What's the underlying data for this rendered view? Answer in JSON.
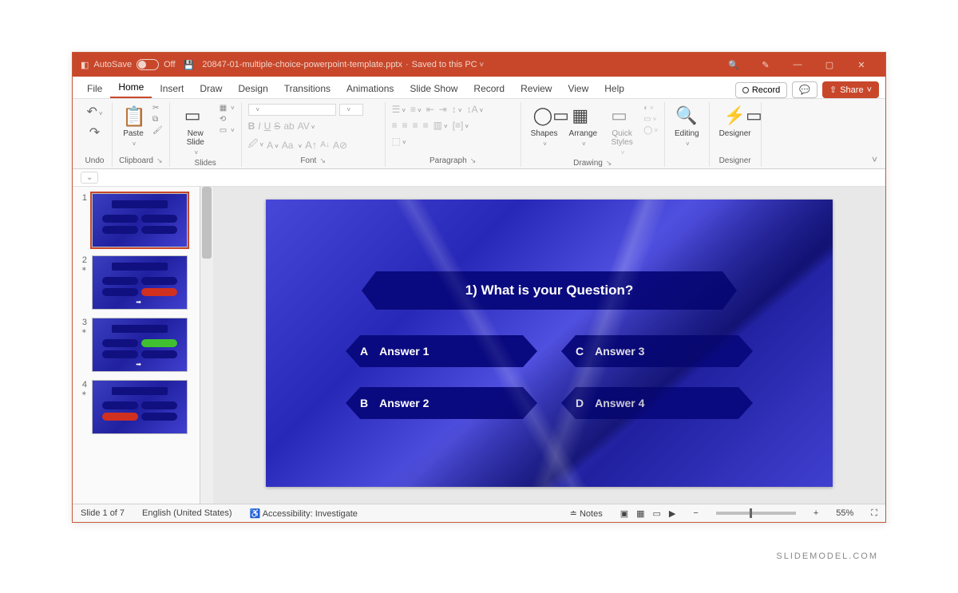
{
  "titlebar": {
    "autosave_label": "AutoSave",
    "autosave_state": "Off",
    "filename": "20847-01-multiple-choice-powerpoint-template.pptx",
    "saved_status": "Saved to this PC"
  },
  "tabs": {
    "file": "File",
    "home": "Home",
    "insert": "Insert",
    "draw": "Draw",
    "design": "Design",
    "transitions": "Transitions",
    "animations": "Animations",
    "slideshow": "Slide Show",
    "record": "Record",
    "review": "Review",
    "view": "View",
    "help": "Help"
  },
  "ribbon_right": {
    "record": "Record",
    "share": "Share"
  },
  "groups": {
    "undo": "Undo",
    "clipboard": "Clipboard",
    "paste": "Paste",
    "slides": "Slides",
    "new_slide": "New Slide",
    "font": "Font",
    "paragraph": "Paragraph",
    "drawing": "Drawing",
    "shapes": "Shapes",
    "arrange": "Arrange",
    "quick_styles": "Quick Styles",
    "editing": "Editing",
    "designer": "Designer"
  },
  "font_btns": {
    "bold": "B",
    "italic": "I",
    "underline": "U",
    "strike": "S",
    "size_up": "A",
    "size_dn": "A",
    "aa": "Aa"
  },
  "slide": {
    "question": "1) What is your Question?",
    "answers": {
      "a": {
        "letter": "A",
        "text": "Answer 1"
      },
      "b": {
        "letter": "C",
        "text": "Answer 3"
      },
      "c": {
        "letter": "B",
        "text": "Answer 2"
      },
      "d": {
        "letter": "D",
        "text": "Answer 4"
      }
    }
  },
  "thumbnails": {
    "n1": "1",
    "n2": "2",
    "n3": "3",
    "n4": "4"
  },
  "statusbar": {
    "slide_count": "Slide 1 of 7",
    "language": "English (United States)",
    "accessibility": "Accessibility: Investigate",
    "notes": "Notes",
    "zoom": "55%"
  },
  "watermark": "SLIDEMODEL.COM"
}
